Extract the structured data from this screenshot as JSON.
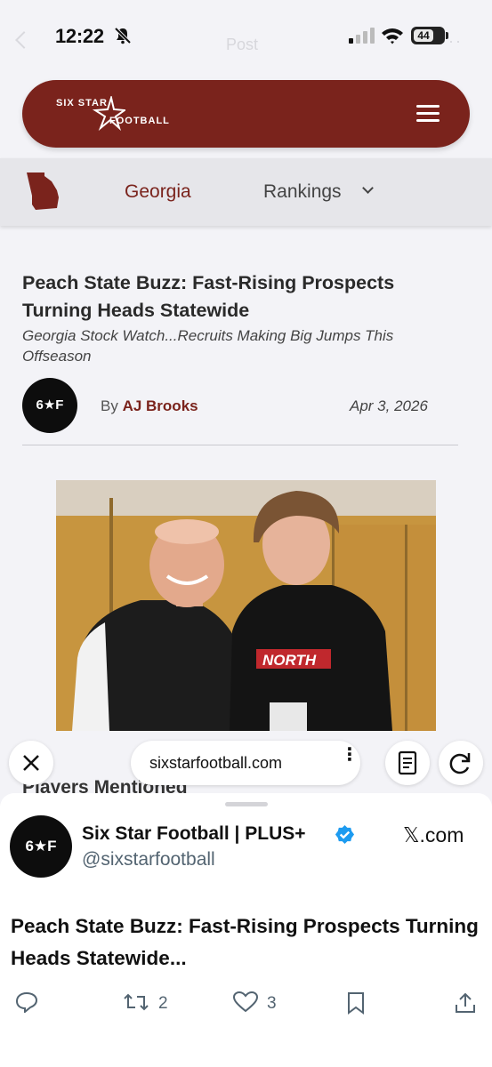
{
  "status_bar": {
    "time": "12:22",
    "battery": "44",
    "ghost_title": "Post",
    "ghost_menu": "···"
  },
  "site": {
    "logo_top": "SIX STAR",
    "logo_bottom": "FOOTBALL",
    "brand_color": "#7a231c"
  },
  "nav": {
    "state": "Georgia",
    "rankings": "Rankings"
  },
  "article": {
    "title": "Peach State Buzz: Fast-Rising Prospects Turning Heads Statewide",
    "subtitle": "Georgia Stock Watch...Recruits Making Big Jumps This Offseason",
    "avatar_text": "6★F",
    "by": "By",
    "author": "AJ Brooks",
    "date": "Apr 3, 2026",
    "partial_heading": "Players Mentioned",
    "photo_text": "NORTH"
  },
  "browser": {
    "url": "sixstarfootball.com",
    "more": "⋮"
  },
  "tweet": {
    "avatar_text": "6★F",
    "account_name": "Six Star Football | PLUS+",
    "handle": "@sixstarfootball",
    "source": "𝕏.com",
    "text": "Peach State Buzz: Fast-Rising Prospects Turning Heads Statewide...",
    "retweets": "2",
    "likes": "3"
  }
}
